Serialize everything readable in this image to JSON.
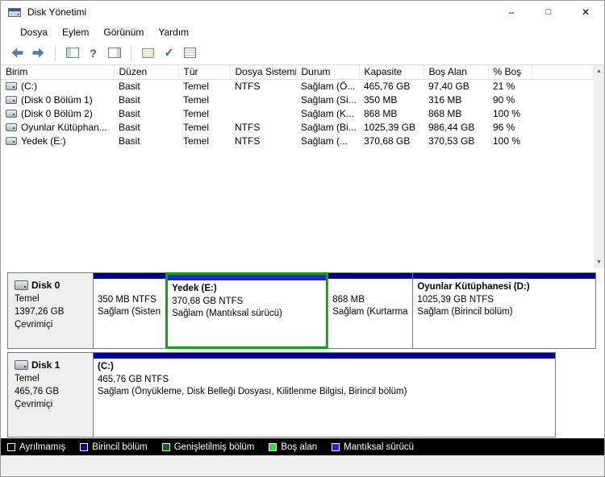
{
  "window": {
    "title": "Disk Yönetimi",
    "controls": {
      "minimize": "–",
      "maximize": "□",
      "close": "✕"
    }
  },
  "menubar": {
    "items": [
      "Dosya",
      "Eylem",
      "Görünüm",
      "Yardım"
    ]
  },
  "toolbar": {
    "icon_names": [
      "back-icon",
      "forward-icon",
      "console-tree-icon",
      "help-icon",
      "action-pane-icon",
      "dialog-icon",
      "check-icon",
      "list-icon"
    ]
  },
  "icons": {
    "help": "?",
    "check": "✓",
    "scroll_up": "▲",
    "scroll_down": "▼"
  },
  "volume_table": {
    "columns": [
      "Birim",
      "Düzen",
      "Tür",
      "Dosya Sistemi",
      "Durum",
      "Kapasite",
      "Boş Alan",
      "% Boş"
    ],
    "rows": [
      [
        "(C:)",
        "Basit",
        "Temel",
        "NTFS",
        "Sağlam (Ö...",
        "465,76 GB",
        "97,40 GB",
        "21 %"
      ],
      [
        "(Disk 0 Bölüm 1)",
        "Basit",
        "Temel",
        "",
        "Sağlam (Si...",
        "350 MB",
        "316 MB",
        "90 %"
      ],
      [
        "(Disk 0 Bölüm 2)",
        "Basit",
        "Temel",
        "",
        "Sağlam (K...",
        "868 MB",
        "868 MB",
        "100 %"
      ],
      [
        "Oyunlar Kütüphan...",
        "Basit",
        "Temel",
        "NTFS",
        "Sağlam (Bi...",
        "1025,39 GB",
        "986,44 GB",
        "96 %"
      ],
      [
        "Yedek (E:)",
        "Basit",
        "Temel",
        "NTFS",
        "Sağlam (...",
        "370,68 GB",
        "370,53 GB",
        "100 %"
      ]
    ]
  },
  "disks": [
    {
      "name": "Disk 0",
      "type": "Temel",
      "capacity": "1397,26 GB",
      "status": "Çevrimiçi",
      "partitions": [
        {
          "title": "",
          "size": "350 MB NTFS",
          "status": "Sağlam (Sisten",
          "kind": "primary"
        },
        {
          "title": "Yedek  (E:)",
          "size": "370,68 GB NTFS",
          "status": "Sağlam (Mantıksal sürücü)",
          "kind": "logical"
        },
        {
          "title": "",
          "size": "868 MB",
          "status": "Sağlam (Kurtarma",
          "kind": "primary"
        },
        {
          "title": "Oyunlar Kütüphanesi  (D:)",
          "size": "1025,39 GB NTFS",
          "status": "Sağlam (Birincil bölüm)",
          "kind": "primary"
        }
      ]
    },
    {
      "name": "Disk 1",
      "type": "Temel",
      "capacity": "465,76 GB",
      "status": "Çevrimiçi",
      "partitions": [
        {
          "title": "(C:)",
          "size": "465,76 GB NTFS",
          "status": "Sağlam (Önyükleme, Disk Belleği Dosyası, Kilitlenme Bilgisi, Birincil bölüm)",
          "kind": "primary"
        }
      ]
    }
  ],
  "legend": {
    "items": [
      {
        "label": "Ayrılmamış",
        "color": "#000000"
      },
      {
        "label": "Birincil bölüm",
        "color": "#00008f"
      },
      {
        "label": "Genişletilmiş bölüm",
        "color": "#0a640a"
      },
      {
        "label": "Boş alan",
        "color": "#35e035"
      },
      {
        "label": "Mantıksal sürücü",
        "color": "#2222e0"
      }
    ]
  },
  "colors": {
    "primary_strip": "#00008f",
    "logical_strip": "#2222e0",
    "extended_border": "#0fa30f"
  }
}
